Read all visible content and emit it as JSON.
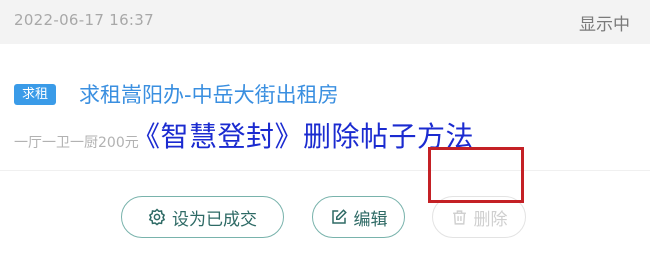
{
  "header": {
    "timestamp": "2022-06-17 16:37",
    "status": "显示中"
  },
  "listing": {
    "badge": "求租",
    "title": "求租嵩阳办-中岳大街出租房",
    "description": "一厅一卫一厨200元"
  },
  "overlay": {
    "title": "《智慧登封》删除帖子方法"
  },
  "actions": {
    "mark_complete": "设为已成交",
    "edit": "编辑",
    "delete": "删除"
  },
  "colors": {
    "accent": "#3a9be8",
    "button_border": "#79b3ac",
    "overlay_text": "#1b2bd0",
    "highlight": "#c42025"
  },
  "icons": {
    "mark_complete": "gear-icon",
    "edit": "edit-icon",
    "delete": "trash-icon"
  }
}
